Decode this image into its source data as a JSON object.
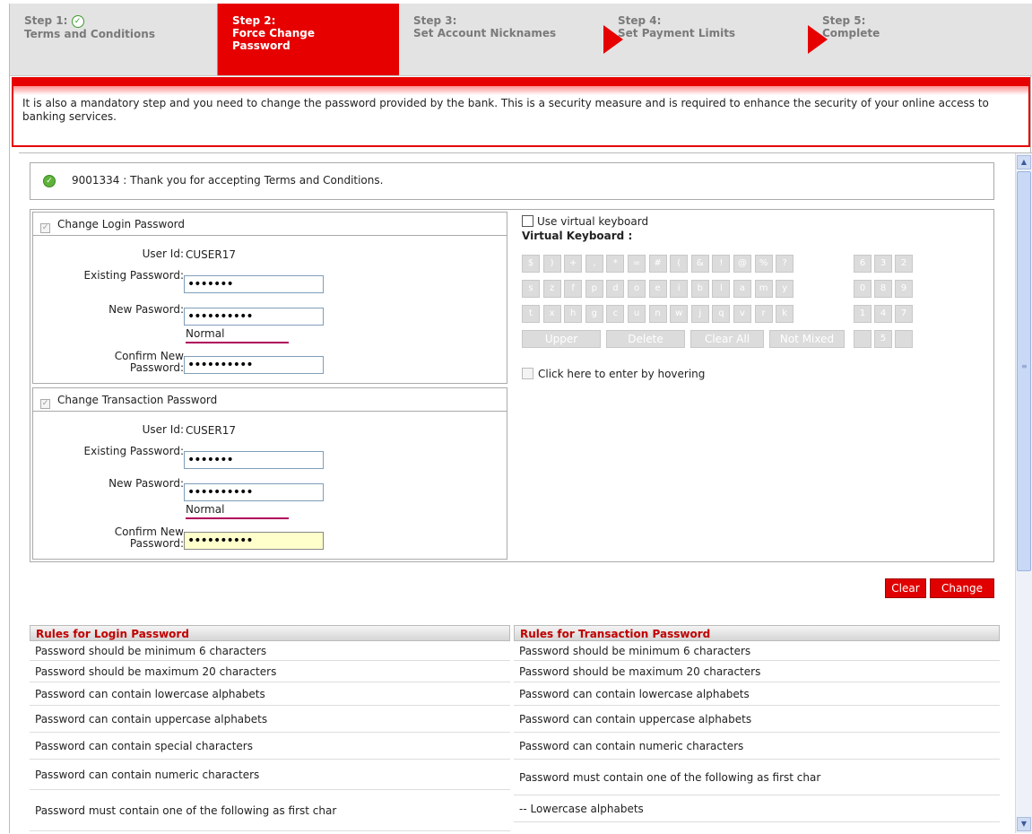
{
  "steps": [
    {
      "num": "Step 1:",
      "label": "Terms and Conditions",
      "done": true
    },
    {
      "num": "Step 2:",
      "label": "Force Change Password",
      "active": true
    },
    {
      "num": "Step 3:",
      "label": "Set Account Nicknames"
    },
    {
      "num": "Step 4:",
      "label": "Set Payment Limits"
    },
    {
      "num": "Step 5:",
      "label": "Complete"
    }
  ],
  "banner": "It is also a mandatory step and you need to change the password provided by the bank. This is a security measure and is required to enhance the security of your online access to banking services.",
  "notice": "9001334 : Thank you for accepting Terms and Conditions.",
  "login": {
    "header": "Change Login Password",
    "user_id_label": "User Id:",
    "user_id": "CUSER17",
    "existing_label": "Existing Password:",
    "existing_value": "•••••••",
    "new_label": "New Pasword:",
    "new_value": "••••••••••",
    "strength": "Normal",
    "confirm_label_1": "Confirm New",
    "confirm_label_2": "Password:",
    "confirm_value": "••••••••••"
  },
  "transaction": {
    "header": "Change Transaction Password",
    "user_id_label": "User Id:",
    "user_id": "CUSER17",
    "existing_label": "Existing Password:",
    "existing_value": "•••••••",
    "new_label": "New Pasword:",
    "new_value": "••••••••••",
    "strength": "Normal",
    "confirm_label_1": "Confirm New",
    "confirm_label_2": "Password:",
    "confirm_value": "••••••••••"
  },
  "vk": {
    "toggle_label": "Use virtual keyboard",
    "title": "Virtual Keyboard :",
    "rows": [
      [
        "$",
        ")",
        "+",
        ",",
        "*",
        "=",
        "#",
        "(",
        "&",
        "!",
        "@",
        "%",
        "?"
      ],
      [
        "s",
        "z",
        "f",
        "p",
        "d",
        "o",
        "e",
        "i",
        "b",
        "l",
        "a",
        "m",
        "y"
      ],
      [
        "t",
        "x",
        "h",
        "g",
        "c",
        "u",
        "n",
        "w",
        "j",
        "q",
        "v",
        "r",
        "k"
      ]
    ],
    "numpad": [
      [
        "6",
        "3",
        "2"
      ],
      [
        "0",
        "8",
        "9"
      ],
      [
        "1",
        "4",
        "7"
      ],
      [
        "",
        "5",
        ""
      ]
    ],
    "buttons": [
      "Upper",
      "Delete",
      "Clear All",
      "Not Mixed"
    ],
    "hover_label": "Click here to enter by hovering"
  },
  "actions": {
    "clear": "Clear",
    "change": "Change"
  },
  "rules_login": {
    "title": "Rules for Login Password",
    "items": [
      "Password should be minimum 6 characters",
      "Password should be maximum 20 characters",
      "Password can contain lowercase alphabets",
      "Password can contain uppercase alphabets",
      "Password can contain special characters",
      "Password can contain numeric characters",
      "Password must contain one of the following as first char"
    ]
  },
  "rules_transaction": {
    "title": "Rules for Transaction Password",
    "items": [
      "Password should be minimum 6 characters",
      "Password should be maximum 20 characters",
      "Password can contain lowercase alphabets",
      "Password can contain uppercase alphabets",
      "Password can contain numeric characters",
      "Password must contain one of the following as first char",
      "-- Lowercase alphabets"
    ]
  }
}
